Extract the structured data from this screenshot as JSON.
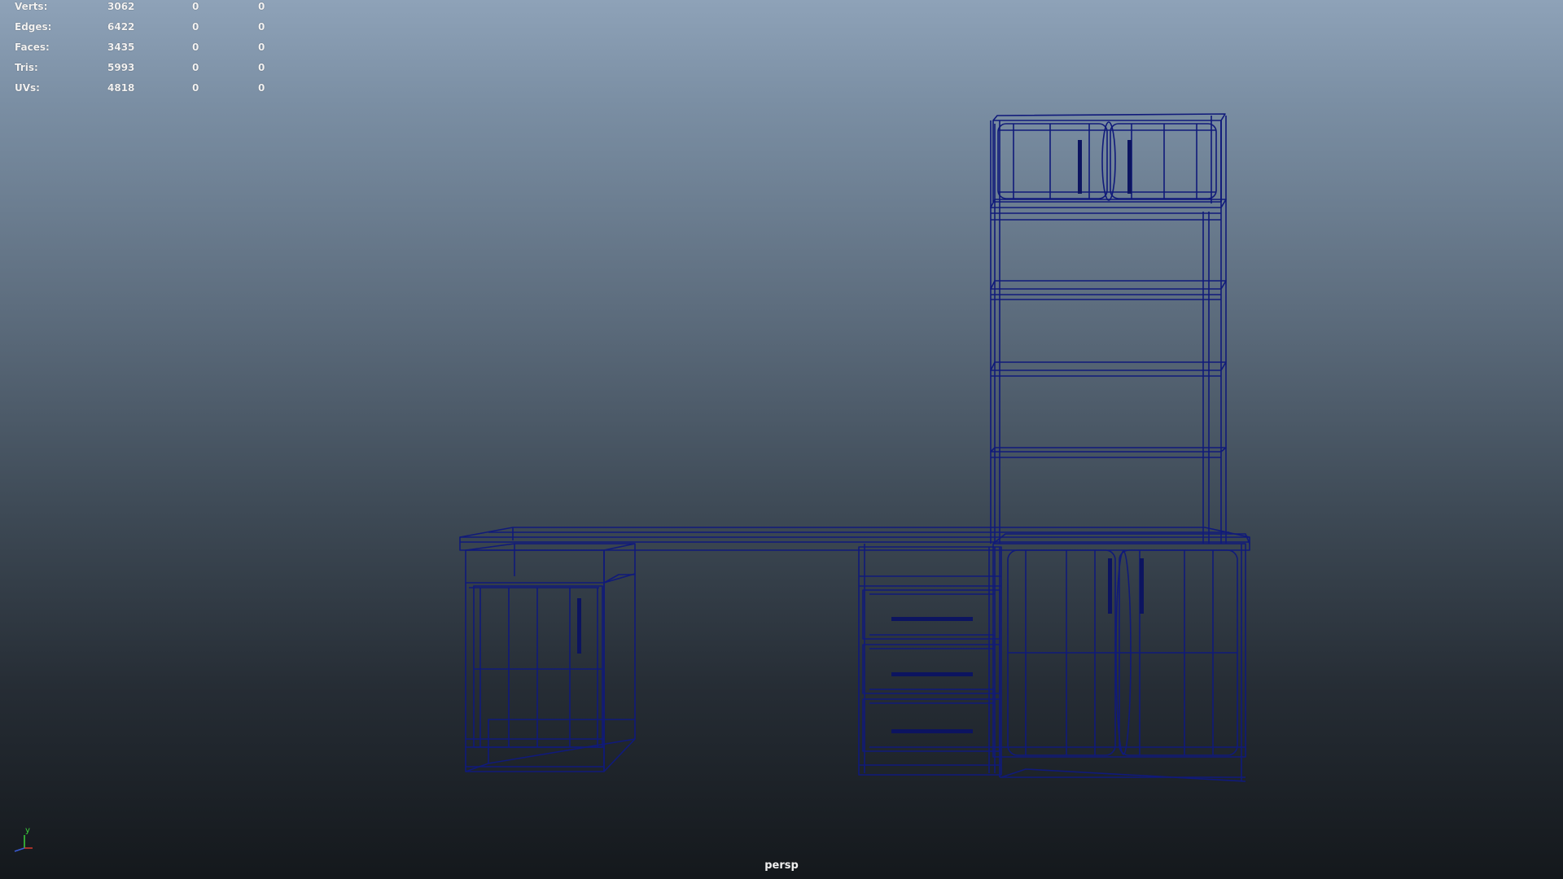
{
  "viewport": {
    "camera_label": "persp",
    "wire_color": "#101a7a",
    "handle_color": "#0c1460"
  },
  "poly_count": {
    "rows": [
      {
        "label": "Verts:",
        "values": [
          "3062",
          "0",
          "0"
        ]
      },
      {
        "label": "Edges:",
        "values": [
          "6422",
          "0",
          "0"
        ]
      },
      {
        "label": "Faces:",
        "values": [
          "3435",
          "0",
          "0"
        ]
      },
      {
        "label": "Tris:",
        "values": [
          "5993",
          "0",
          "0"
        ]
      },
      {
        "label": "UVs:",
        "values": [
          "4818",
          "0",
          "0"
        ]
      }
    ]
  },
  "axis_gizmo": {
    "y_label": "y",
    "x_color": "#d23a2e",
    "y_color": "#3bd23b",
    "z_color": "#3a5ad2"
  }
}
